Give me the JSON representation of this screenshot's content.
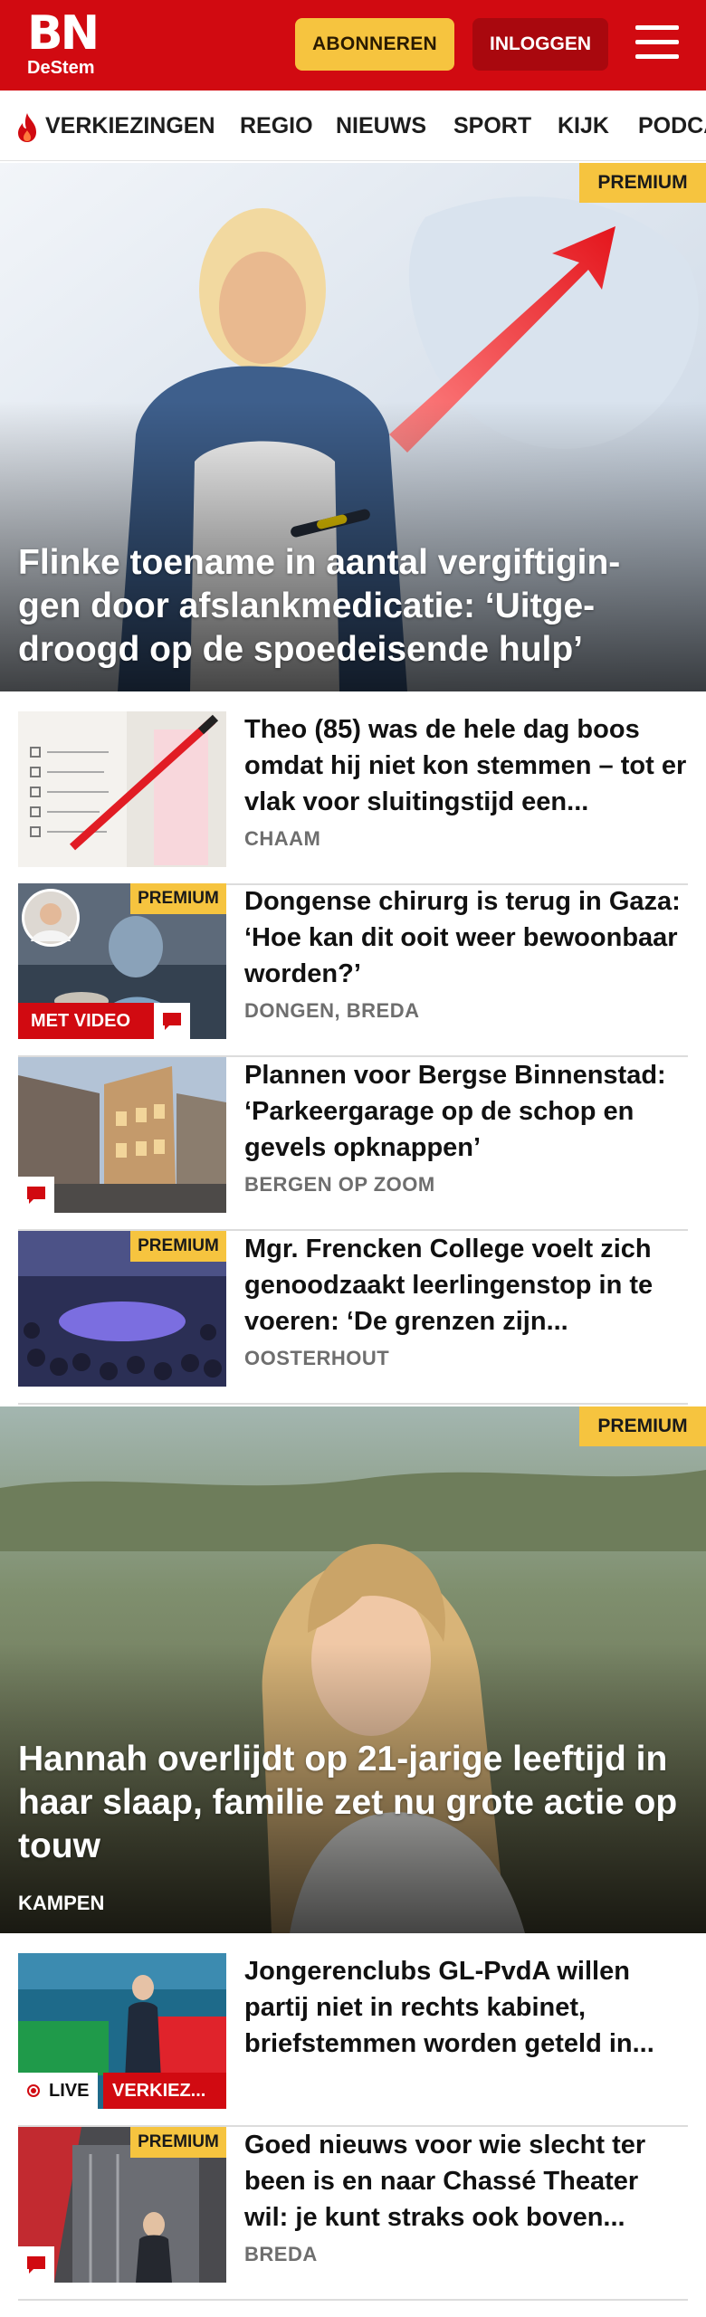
{
  "header": {
    "logo_main": "BN",
    "logo_sub": "DeStem",
    "subscribe_label": "ABONNEREN",
    "login_label": "INLOGGEN"
  },
  "nav": {
    "items": [
      "VERKIEZINGEN",
      "REGIO",
      "NIEUWS",
      "SPORT",
      "KIJK",
      "PODCAST"
    ]
  },
  "badges": {
    "premium": "PREMIUM",
    "video": "MET VIDEO",
    "live": "LIVE",
    "elections": "VERKIEZ..."
  },
  "hero1": {
    "title": "Flinke toename in aantal vergiftigin-gen door afslankmedicatie: ‘Uitge-droogd op de spoedeisende hulp’",
    "premium": true
  },
  "articles1": [
    {
      "title": "Theo (85) was de hele dag boos omdat hij niet kon stemmen – tot er vlak voor sluitingstijd een...",
      "location": "CHAAM"
    },
    {
      "title": "Dongense chirurg is terug in Gaza: ‘Hoe kan dit ooit weer bewoonbaar worden?’",
      "location": "DONGEN, BREDA"
    },
    {
      "title": "Plannen voor Bergse Binnenstad: ‘Parkeergarage op de schop en gevels opknappen’",
      "location": "BERGEN OP ZOOM"
    },
    {
      "title": "Mgr. Frencken College voelt zich genoodzaakt leerlingenstop in te voeren: ‘De grenzen zijn...",
      "location": "OOSTERHOUT"
    }
  ],
  "hero2": {
    "title": "Hannah overlijdt op 21-jarige leeftijd in haar slaap, familie zet nu grote actie op touw",
    "location": "KAMPEN"
  },
  "articles2": [
    {
      "title": "Jongerenclubs GL-PvdA willen partij niet in rechts kabinet, briefstemmen worden geteld in...",
      "location": ""
    },
    {
      "title": "Goed nieuws voor wie slecht ter been is en naar Chassé Theater wil: je kunt straks ook boven...",
      "location": "BREDA"
    }
  ],
  "colors": {
    "brand_red": "#d10a11",
    "premium_yellow": "#f6c43f"
  }
}
